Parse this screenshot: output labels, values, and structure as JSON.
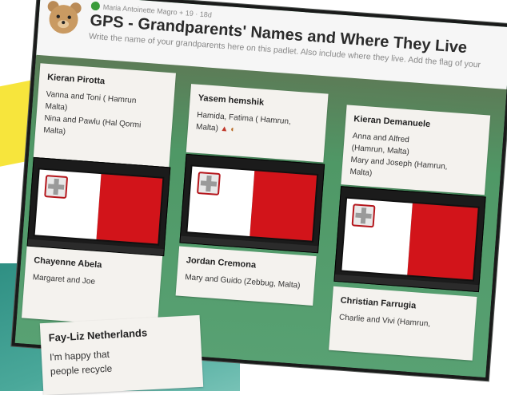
{
  "header": {
    "meta": "Maria Antoinette Magro + 19 · 18d",
    "title": "GPS - Grandparents' Names and Where They Live",
    "description": "Write the name of your grandparents here on this padlet. Also include where they live. Add the flag of your"
  },
  "posts": [
    {
      "author": "Kieran Pirotta",
      "lines": [
        "Vanna and Toni ( Hamrun",
        "Malta)",
        "Nina and Pawlu (Hal Qormi",
        "Malta)"
      ]
    },
    {
      "author": "Yasem hemshik",
      "lines": [
        "Hamida,  Fatima ( Hamrun,",
        "Malta)"
      ]
    },
    {
      "author": "Kieran Demanuele",
      "lines": [
        "Anna and Alfred",
        "(Hamrun, Malta)",
        "Mary and Joseph (Hamrun,",
        "Malta)"
      ]
    },
    {
      "author": "Chayenne Abela",
      "lines": [
        "Margaret and Joe"
      ]
    },
    {
      "author": "Jordan Cremona",
      "lines": [
        "Mary and Guido (Zebbug, Malta)"
      ]
    },
    {
      "author": "Christian Farrugia",
      "lines": [
        "Charlie and  Vivi (Hamrun,"
      ]
    },
    {
      "author": "Fay-Liz  Netherlands",
      "lines": [
        "I'm happy that",
        "people recycle"
      ]
    }
  ],
  "icons": {
    "header_avatar": "bear-icon",
    "author_avatar": "user-avatar-icon",
    "emoji": "bird-icon",
    "flag": "malta-flag"
  }
}
